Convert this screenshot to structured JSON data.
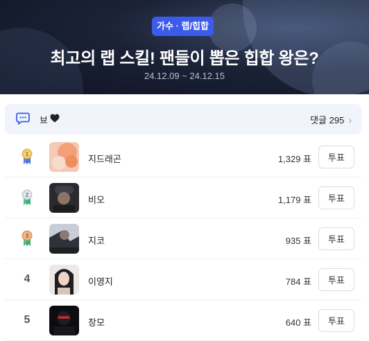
{
  "header": {
    "category_badge": "가수 · 랩/힙합",
    "title": "최고의 랩 스킬! 팬들이 뽑은 힙합 왕은?",
    "date_range": "24.12.09 ~ 24.12.15"
  },
  "comment_bar": {
    "reaction_label": "뵤",
    "comment_label": "댓글 295",
    "chat_icon": "chat-bubble-icon",
    "heart_icon": "black-heart-icon"
  },
  "ranking": [
    {
      "rank": "1",
      "medal": "gold",
      "name": "지드래곤",
      "votes": "1,329 표",
      "button": "투표"
    },
    {
      "rank": "2",
      "medal": "silver",
      "name": "비오",
      "votes": "1,179 표",
      "button": "투표"
    },
    {
      "rank": "3",
      "medal": "bronze",
      "name": "지코",
      "votes": "935 표",
      "button": "투표"
    },
    {
      "rank": "4",
      "medal": "",
      "name": "이영지",
      "votes": "784 표",
      "button": "투표"
    },
    {
      "rank": "5",
      "medal": "",
      "name": "창모",
      "votes": "640 표",
      "button": "투표"
    }
  ],
  "colors": {
    "badge": "#3b5bea",
    "medal_gold": "#e7b94a",
    "medal_silver": "#c9ced6",
    "medal_bronze": "#e09a62",
    "ribbon_blue": "#5a86e6",
    "ribbon_green": "#4cc38a"
  }
}
